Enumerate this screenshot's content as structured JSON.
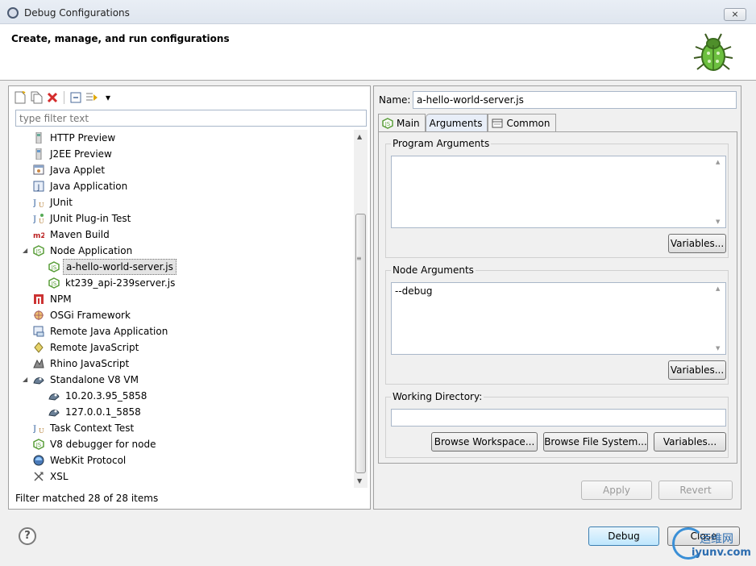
{
  "window": {
    "title": "Debug Configurations",
    "close_label": "⨯"
  },
  "header": {
    "heading": "Create, manage, and run configurations"
  },
  "filter": {
    "placeholder": "type filter text"
  },
  "tree": [
    {
      "label": "HTTP Preview",
      "icon": "http-preview-icon",
      "depth": 0
    },
    {
      "label": "J2EE Preview",
      "icon": "j2ee-preview-icon",
      "depth": 0
    },
    {
      "label": "Java Applet",
      "icon": "java-applet-icon",
      "depth": 0
    },
    {
      "label": "Java Application",
      "icon": "java-application-icon",
      "depth": 0
    },
    {
      "label": "JUnit",
      "icon": "junit-icon",
      "depth": 0
    },
    {
      "label": "JUnit Plug-in Test",
      "icon": "junit-plugin-icon",
      "depth": 0
    },
    {
      "label": "Maven Build",
      "icon": "maven-icon",
      "depth": 0
    },
    {
      "label": "Node Application",
      "icon": "node-icon",
      "depth": 0,
      "expanded": true
    },
    {
      "label": "a-hello-world-server.js",
      "icon": "node-icon",
      "depth": 1,
      "selected": true
    },
    {
      "label": "kt239_api-239server.js",
      "icon": "node-icon",
      "depth": 1
    },
    {
      "label": "NPM",
      "icon": "npm-icon",
      "depth": 0
    },
    {
      "label": "OSGi Framework",
      "icon": "osgi-icon",
      "depth": 0
    },
    {
      "label": "Remote Java Application",
      "icon": "remote-java-icon",
      "depth": 0
    },
    {
      "label": "Remote JavaScript",
      "icon": "remote-javascript-icon",
      "depth": 0
    },
    {
      "label": "Rhino JavaScript",
      "icon": "rhino-icon",
      "depth": 0
    },
    {
      "label": "Standalone V8 VM",
      "icon": "v8-vm-icon",
      "depth": 0,
      "expanded": true
    },
    {
      "label": "10.20.3.95_5858",
      "icon": "v8-vm-icon",
      "depth": 1
    },
    {
      "label": "127.0.0.1_5858",
      "icon": "v8-vm-icon",
      "depth": 1
    },
    {
      "label": "Task Context Test",
      "icon": "task-context-icon",
      "depth": 0
    },
    {
      "label": "V8 debugger for node",
      "icon": "node-icon",
      "depth": 0
    },
    {
      "label": "WebKit Protocol",
      "icon": "webkit-icon",
      "depth": 0
    },
    {
      "label": "XSL",
      "icon": "xsl-icon",
      "depth": 0
    }
  ],
  "status": "Filter matched 28 of 28 items",
  "config": {
    "name_label": "Name:",
    "name_value": "a-hello-world-server.js",
    "tabs": [
      {
        "label": "Main",
        "icon": "node-icon"
      },
      {
        "label": "Arguments",
        "icon": "",
        "active": true
      },
      {
        "label": "Common",
        "icon": "common-tab-icon"
      }
    ],
    "program_args": {
      "label": "Program Arguments",
      "value": "",
      "variables": "Variables..."
    },
    "node_args": {
      "label": "Node Arguments",
      "value": "--debug",
      "variables": "Variables..."
    },
    "working_dir": {
      "label": "Working Directory:",
      "value": "",
      "browse_workspace": "Browse Workspace...",
      "browse_fs": "Browse File System...",
      "variables": "Variables..."
    },
    "apply": "Apply",
    "revert": "Revert"
  },
  "footer": {
    "debug": "Debug",
    "close": "Close"
  },
  "watermark": {
    "top": "运维网",
    "bottom": "iyunv.com"
  },
  "colors": {
    "node_green": "#5a9e3a",
    "delete_red": "#d42b2b",
    "accent_blue": "#3c7fb1"
  }
}
